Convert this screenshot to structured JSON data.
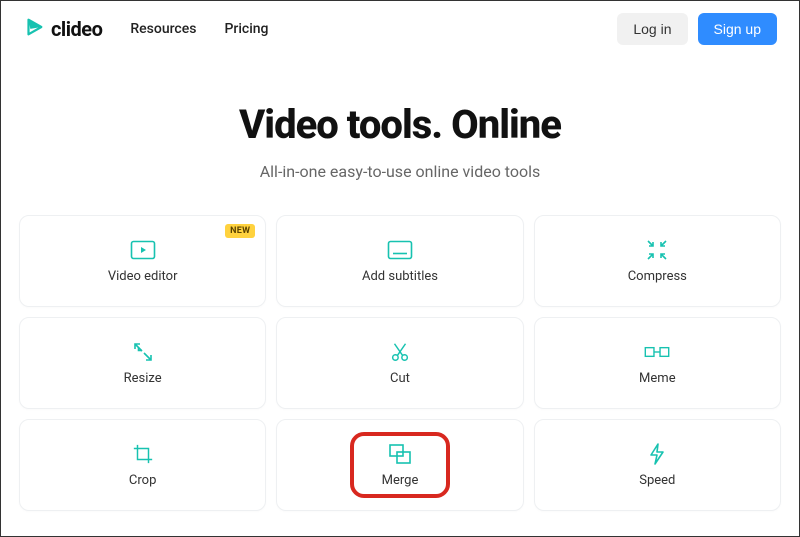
{
  "header": {
    "brand": "clideo",
    "nav": {
      "resources": "Resources",
      "pricing": "Pricing"
    },
    "login": "Log in",
    "signup": "Sign up"
  },
  "hero": {
    "title": "Video tools. Online",
    "subtitle": "All-in-one easy-to-use online video tools"
  },
  "badge": {
    "new": "NEW"
  },
  "tools": {
    "video_editor": "Video editor",
    "add_subtitles": "Add subtitles",
    "compress": "Compress",
    "resize": "Resize",
    "cut": "Cut",
    "meme": "Meme",
    "crop": "Crop",
    "merge": "Merge",
    "speed": "Speed"
  },
  "colors": {
    "accent": "#17c2b0",
    "primary_button": "#2f8cff",
    "badge_bg": "#ffd23e",
    "highlight": "#d8281f"
  }
}
